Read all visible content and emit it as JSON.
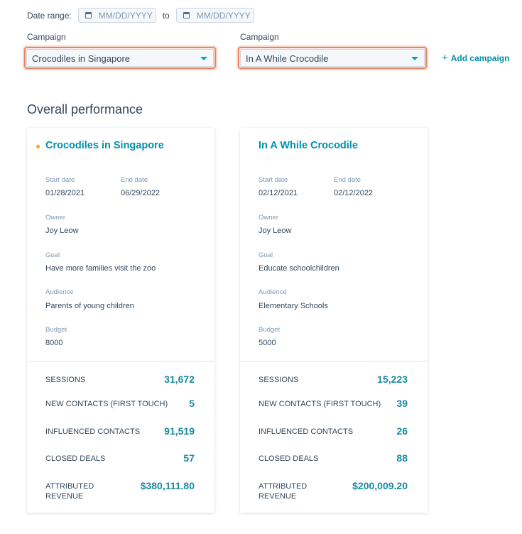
{
  "date_range": {
    "label": "Date range:",
    "start_placeholder": "MM/DD/YYYY",
    "separator": "to",
    "end_placeholder": "MM/DD/YYYY",
    "icon": "calendar-icon"
  },
  "campaign_selects": [
    {
      "label": "Campaign",
      "value": "Crocodiles in Singapore"
    },
    {
      "label": "Campaign",
      "value": "In A While Crocodile"
    }
  ],
  "add_campaign": {
    "icon": "+",
    "label": "Add campaign"
  },
  "section_title": "Overall performance",
  "field_labels": {
    "start_date": "Start date",
    "end_date": "End date",
    "owner": "Owner",
    "goal": "Goal",
    "audience": "Audience",
    "budget": "Budget"
  },
  "metric_labels": {
    "sessions": "SESSIONS",
    "new_contacts": "NEW CONTACTS (FIRST TOUCH)",
    "influenced_contacts": "INFLUENCED CONTACTS",
    "closed_deals": "CLOSED DEALS",
    "attributed_revenue_1": "ATTRIBUTED",
    "attributed_revenue_2": "REVENUE"
  },
  "cards": [
    {
      "title": "Crocodiles in Singapore",
      "start_date": "01/28/2021",
      "end_date": "06/29/2022",
      "owner": "Joy Leow",
      "goal": "Have more families visit the zoo",
      "audience": "Parents of young children",
      "budget": "8000",
      "sessions": "31,672",
      "new_contacts": "5",
      "influenced_contacts": "91,519",
      "closed_deals": "57",
      "attributed_revenue": "$380,111.80",
      "dot_color": "#f5a623"
    },
    {
      "title": "In A While Crocodile",
      "start_date": "02/12/2021",
      "end_date": "02/12/2022",
      "owner": "Joy Leow",
      "goal": "Educate schoolchildren",
      "audience": "Elementary Schools",
      "budget": "5000",
      "sessions": "15,223",
      "new_contacts": "39",
      "influenced_contacts": "26",
      "closed_deals": "88",
      "attributed_revenue": "$200,009.20"
    }
  ],
  "colors": {
    "accent": "#0091ae",
    "highlight_border": "#f0805f",
    "text": "#33475b",
    "muted": "#7c98b6"
  }
}
